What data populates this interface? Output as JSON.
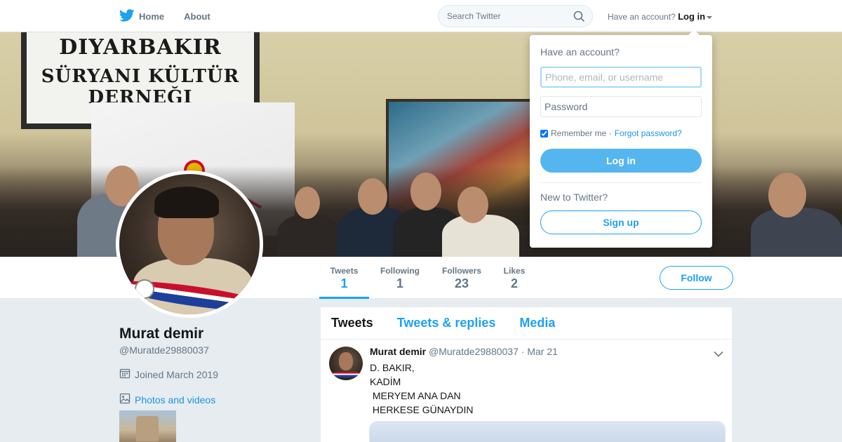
{
  "nav": {
    "home_label": "Home",
    "about_label": "About",
    "search_placeholder": "Search Twitter",
    "account_prompt": "Have an account?",
    "login_label": "Log in"
  },
  "banner": {
    "sign_line1": "DIYARBAKIR",
    "sign_line2": "SÜRYANI KÜLTÜR DERNEĞI"
  },
  "profile": {
    "name": "Murat demir",
    "handle": "@Muratde29880037",
    "joined": "Joined March 2019",
    "photos_link": "Photos and videos"
  },
  "stats": [
    {
      "label": "Tweets",
      "value": "1"
    },
    {
      "label": "Following",
      "value": "1"
    },
    {
      "label": "Followers",
      "value": "23"
    },
    {
      "label": "Likes",
      "value": "2"
    }
  ],
  "follow_label": "Follow",
  "timeline": {
    "tabs": [
      "Tweets",
      "Tweets & replies",
      "Media"
    ],
    "active_tab": "Tweets"
  },
  "tweet": {
    "author": "Murat demir",
    "handle": "@Muratde29880037",
    "date": "· Mar 21",
    "text": "D. BAKIR,\nKADİM\n MERYEM ANA DAN\n HERKESE GÜNAYDIN"
  },
  "login_dropdown": {
    "title": "Have an account?",
    "username_placeholder": "Phone, email, or username",
    "password_placeholder": "Password",
    "remember_label": "Remember me ·",
    "forgot_label": "Forgot password?",
    "login_button": "Log in",
    "new_prompt": "New to Twitter?",
    "signup_button": "Sign up"
  },
  "colors": {
    "accent": "#1da1f2",
    "login_button_bg": "#55b6ef",
    "page_bg": "#e6ecf0"
  },
  "icons": [
    "twitter-bird-icon",
    "home-icon",
    "search-icon",
    "caret-down-icon",
    "calendar-icon",
    "photo-icon",
    "chevron-down-icon"
  ]
}
